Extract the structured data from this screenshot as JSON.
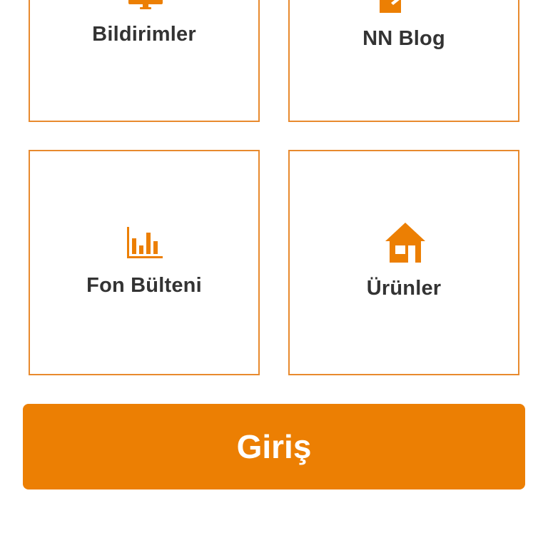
{
  "tiles": [
    {
      "label": "Bildirimler",
      "icon": "monitor-icon"
    },
    {
      "label": "NN Blog",
      "icon": "document-icon"
    },
    {
      "label": "Fon Bülteni",
      "icon": "bar-chart-icon"
    },
    {
      "label": "Ürünler",
      "icon": "home-icon"
    }
  ],
  "login_button": {
    "label": "Giriş"
  },
  "colors": {
    "accent": "#ec7f03",
    "tile_border": "#e88a2e",
    "text": "#333333",
    "background": "#ffffff"
  }
}
